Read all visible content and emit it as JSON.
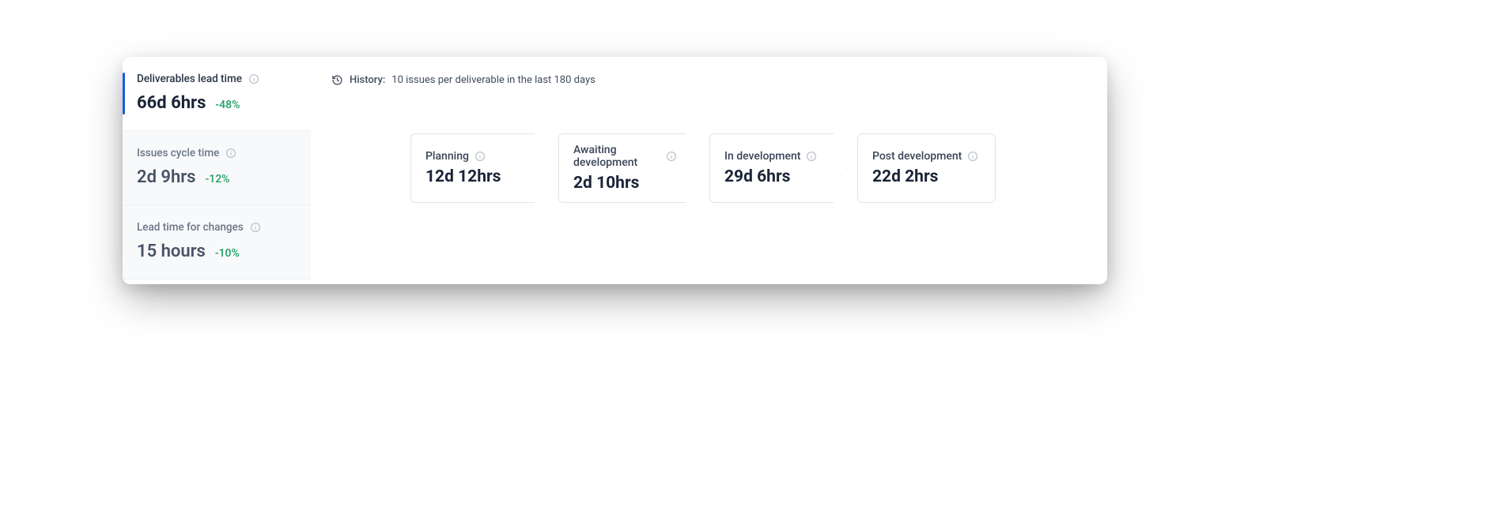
{
  "sidebar": {
    "items": [
      {
        "label": "Deliverables lead time",
        "value": "66d 6hrs",
        "delta": "-48%"
      },
      {
        "label": "Issues cycle time",
        "value": "2d 9hrs",
        "delta": "-12%"
      },
      {
        "label": "Lead time for changes",
        "value": "15 hours",
        "delta": "-10%"
      }
    ]
  },
  "history": {
    "prefix": "History:",
    "text": "10 issues per deliverable in the last 180 days"
  },
  "stages": [
    {
      "label": "Planning",
      "value": "12d 12hrs"
    },
    {
      "label": "Awaiting development",
      "value": "2d 10hrs"
    },
    {
      "label": "In development",
      "value": "29d 6hrs"
    },
    {
      "label": "Post development",
      "value": "22d 2hrs"
    }
  ]
}
